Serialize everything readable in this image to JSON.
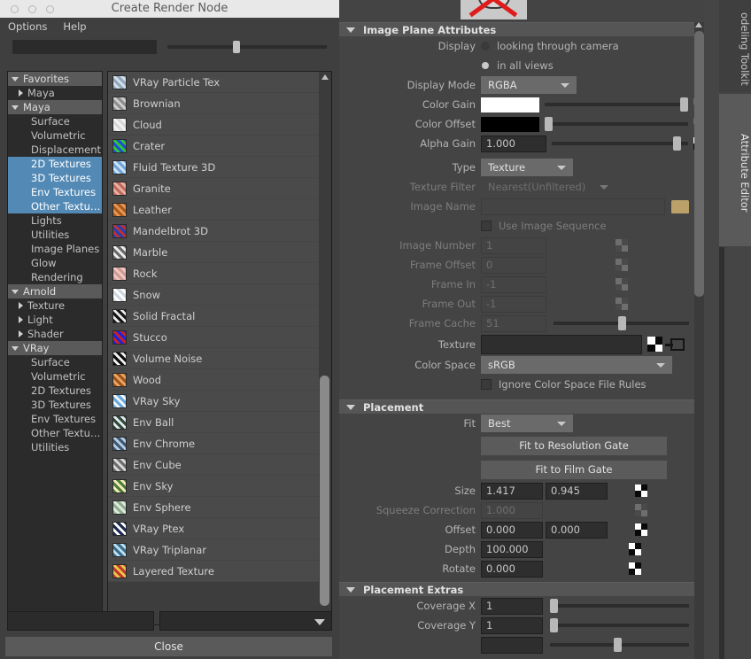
{
  "window": {
    "title": "Create Render Node",
    "menu": [
      "Options",
      "Help"
    ],
    "search_value": "",
    "close_label": "Close"
  },
  "tree": {
    "items": [
      {
        "label": "Favorites",
        "type": "group",
        "indent": 0,
        "arrow": "down",
        "selected": false
      },
      {
        "label": "Maya",
        "type": "child",
        "indent": 1,
        "arrow": "right",
        "selected": false
      },
      {
        "label": "Maya",
        "type": "group",
        "indent": 0,
        "arrow": "down",
        "selected": false
      },
      {
        "label": "Surface",
        "type": "child",
        "indent": 2,
        "arrow": "none",
        "selected": false
      },
      {
        "label": "Volumetric",
        "type": "child",
        "indent": 2,
        "arrow": "none",
        "selected": false
      },
      {
        "label": "Displacement",
        "type": "child",
        "indent": 2,
        "arrow": "none",
        "selected": false
      },
      {
        "label": "2D Textures",
        "type": "child",
        "indent": 2,
        "arrow": "none",
        "selected": true
      },
      {
        "label": "3D Textures",
        "type": "child",
        "indent": 2,
        "arrow": "none",
        "selected": true
      },
      {
        "label": "Env Textures",
        "type": "child",
        "indent": 2,
        "arrow": "none",
        "selected": true
      },
      {
        "label": "Other Textu…",
        "type": "child",
        "indent": 2,
        "arrow": "none",
        "selected": true
      },
      {
        "label": "Lights",
        "type": "child",
        "indent": 2,
        "arrow": "none",
        "selected": false
      },
      {
        "label": "Utilities",
        "type": "child",
        "indent": 2,
        "arrow": "none",
        "selected": false
      },
      {
        "label": "Image Planes",
        "type": "child",
        "indent": 2,
        "arrow": "none",
        "selected": false
      },
      {
        "label": "Glow",
        "type": "child",
        "indent": 2,
        "arrow": "none",
        "selected": false
      },
      {
        "label": "Rendering",
        "type": "child",
        "indent": 2,
        "arrow": "none",
        "selected": false
      },
      {
        "label": "Arnold",
        "type": "group",
        "indent": 0,
        "arrow": "down",
        "selected": false
      },
      {
        "label": "Texture",
        "type": "child",
        "indent": 1,
        "arrow": "right",
        "selected": false
      },
      {
        "label": "Light",
        "type": "child",
        "indent": 1,
        "arrow": "right",
        "selected": false
      },
      {
        "label": "Shader",
        "type": "child",
        "indent": 1,
        "arrow": "right",
        "selected": false
      },
      {
        "label": "VRay",
        "type": "group",
        "indent": 0,
        "arrow": "down",
        "selected": false
      },
      {
        "label": "Surface",
        "type": "child",
        "indent": 2,
        "arrow": "none",
        "selected": false
      },
      {
        "label": "Volumetric",
        "type": "child",
        "indent": 2,
        "arrow": "none",
        "selected": false
      },
      {
        "label": "2D Textures",
        "type": "child",
        "indent": 2,
        "arrow": "none",
        "selected": false
      },
      {
        "label": "3D Textures",
        "type": "child",
        "indent": 2,
        "arrow": "none",
        "selected": false
      },
      {
        "label": "Env Textures",
        "type": "child",
        "indent": 2,
        "arrow": "none",
        "selected": false
      },
      {
        "label": "Other Textu…",
        "type": "child",
        "indent": 2,
        "arrow": "none",
        "selected": false
      },
      {
        "label": "Utilities",
        "type": "child",
        "indent": 2,
        "arrow": "none",
        "selected": false
      }
    ]
  },
  "node_list": {
    "items": [
      {
        "label": "VRay Particle Tex",
        "icon": "vray-particle-tex-icon",
        "c1": "#8fa8bd",
        "c2": "#d6dfe6"
      },
      {
        "label": "Brownian",
        "icon": "brownian-icon",
        "c1": "#8e8e8e",
        "c2": "#cfcfcf"
      },
      {
        "label": "Cloud",
        "icon": "cloud-icon",
        "c1": "#d8d8d8",
        "c2": "#f2f2f2"
      },
      {
        "label": "Crater",
        "icon": "crater-icon",
        "c1": "#1e4fd2",
        "c2": "#32c832"
      },
      {
        "label": "Fluid Texture 3D",
        "icon": "fluid-texture-3d-icon",
        "c1": "#6fa5d8",
        "c2": "#cfe4f5"
      },
      {
        "label": "Granite",
        "icon": "granite-icon",
        "c1": "#c06a5e",
        "c2": "#e8b0a4"
      },
      {
        "label": "Leather",
        "icon": "leather-icon",
        "c1": "#b0581f",
        "c2": "#e39a52"
      },
      {
        "label": "Mandelbrot 3D",
        "icon": "mandelbrot-3d-icon",
        "c1": "#2a3fb0",
        "c2": "#c03030"
      },
      {
        "label": "Marble",
        "icon": "marble-icon",
        "c1": "#6a6a6a",
        "c2": "#ededed"
      },
      {
        "label": "Rock",
        "icon": "rock-icon",
        "c1": "#d09a96",
        "c2": "#f0c8c4"
      },
      {
        "label": "Snow",
        "icon": "snow-icon",
        "c1": "#cfd6dd",
        "c2": "#ffffff"
      },
      {
        "label": "Solid Fractal",
        "icon": "solid-fractal-icon",
        "c1": "#141414",
        "c2": "#e8e8e8"
      },
      {
        "label": "Stucco",
        "icon": "stucco-icon",
        "c1": "#1d24d6",
        "c2": "#d02020"
      },
      {
        "label": "Volume Noise",
        "icon": "volume-noise-icon",
        "c1": "#0c0c0c",
        "c2": "#f0f0f0"
      },
      {
        "label": "Wood",
        "icon": "wood-icon",
        "c1": "#a0531c",
        "c2": "#e8a860"
      },
      {
        "label": "VRay Sky",
        "icon": "vray-sky-icon",
        "c1": "#6aa8dc",
        "c2": "#f4f8fb"
      },
      {
        "label": "Env Ball",
        "icon": "env-ball-icon",
        "c1": "#2f4a34",
        "c2": "#dfe9f2"
      },
      {
        "label": "Env Chrome",
        "icon": "env-chrome-icon",
        "c1": "#3e5878",
        "c2": "#b8cde0"
      },
      {
        "label": "Env Cube",
        "icon": "env-cube-icon",
        "c1": "#6e6e6e",
        "c2": "#d8d8d8"
      },
      {
        "label": "Env Sky",
        "icon": "env-sky-icon",
        "c1": "#4f7d34",
        "c2": "#f0ecc0"
      },
      {
        "label": "Env Sphere",
        "icon": "env-sphere-icon",
        "c1": "#8fae8f",
        "c2": "#dfe9df"
      },
      {
        "label": "VRay Ptex",
        "icon": "vray-ptex-icon",
        "c1": "#1a2a50",
        "c2": "#ffffff"
      },
      {
        "label": "VRay Triplanar",
        "icon": "vray-triplanar-icon",
        "c1": "#3a6e8e",
        "c2": "#bfe0ef"
      },
      {
        "label": "Layered Texture",
        "icon": "layered-texture-icon",
        "c1": "#c0392b",
        "c2": "#e8c84a"
      }
    ]
  },
  "tabs": {
    "modeling_toolkit": "odeling Toolkit",
    "attribute_editor": "Attribute Editor"
  },
  "attribute_editor": {
    "image_plane": {
      "section_title": "Image Plane Attributes",
      "display_label": "Display",
      "display_option_1": "looking through camera",
      "display_option_2": "in all views",
      "display_selected": "in all views",
      "display_mode_label": "Display Mode",
      "display_mode_value": "RGBA",
      "color_gain_label": "Color Gain",
      "color_gain_swatch": "#ffffff",
      "color_offset_label": "Color Offset",
      "color_offset_swatch": "#000000",
      "alpha_gain_label": "Alpha Gain",
      "alpha_gain_value": "1.000",
      "type_label": "Type",
      "type_value": "Texture",
      "texture_filter_label": "Texture Filter",
      "texture_filter_value": "Nearest(Unfiltered)",
      "image_name_label": "Image Name",
      "image_name_value": "",
      "use_image_sequence_label": "Use Image Sequence",
      "use_image_sequence_checked": false,
      "image_number_label": "Image Number",
      "image_number_value": "1",
      "frame_offset_label": "Frame Offset",
      "frame_offset_value": "0",
      "frame_in_label": "Frame In",
      "frame_in_value": "-1",
      "frame_out_label": "Frame Out",
      "frame_out_value": "-1",
      "frame_cache_label": "Frame Cache",
      "frame_cache_value": "51",
      "texture_label": "Texture",
      "texture_value": "",
      "color_space_label": "Color Space",
      "color_space_value": "sRGB",
      "ignore_color_space_label": "Ignore Color Space File Rules",
      "ignore_color_space_checked": false
    },
    "placement": {
      "section_title": "Placement",
      "fit_label": "Fit",
      "fit_value": "Best",
      "fit_resolution_gate_label": "Fit to Resolution Gate",
      "fit_film_gate_label": "Fit to Film Gate",
      "size_label": "Size",
      "size_x": "1.417",
      "size_y": "0.945",
      "squeeze_label": "Squeeze Correction",
      "squeeze_value": "1.000",
      "offset_label": "Offset",
      "offset_x": "0.000",
      "offset_y": "0.000",
      "depth_label": "Depth",
      "depth_value": "100.000",
      "rotate_label": "Rotate",
      "rotate_value": "0.000"
    },
    "placement_extras": {
      "section_title": "Placement Extras",
      "coverage_x_label": "Coverage X",
      "coverage_x_value": "1",
      "coverage_y_label": "Coverage Y",
      "coverage_y_value": "1"
    }
  },
  "colors": {
    "selection_blue": "#5289b5",
    "panel_bg": "#444444",
    "window_bg": "#3f3f3f",
    "section_header": "#555555"
  }
}
